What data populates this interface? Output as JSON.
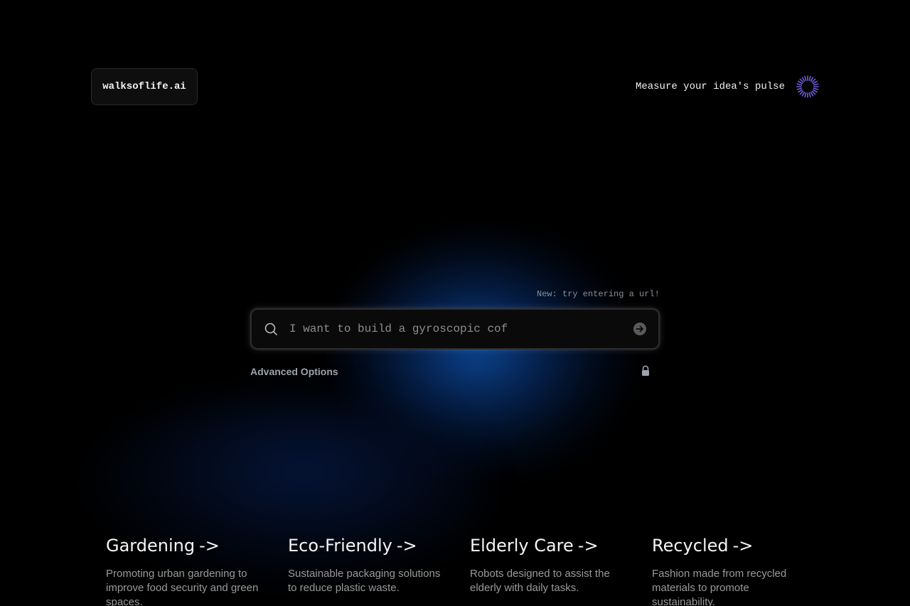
{
  "header": {
    "logo": "walksoflife.ai",
    "pulse_link": "Measure your idea's pulse"
  },
  "search": {
    "hint": "New: try entering a url!",
    "placeholder": "I want to build a gyroscopic cof",
    "advanced_label": "Advanced Options"
  },
  "colors": {
    "accent": "#6b5bd6",
    "glow": "#0c4a9c"
  },
  "icons": {
    "pulse": "spinner-icon",
    "search": "search-icon",
    "submit": "arrow-right-circle-icon",
    "lock": "lock-icon"
  },
  "cards": [
    {
      "title": "Gardening",
      "arrow": "->",
      "desc": "Promoting urban gardening to improve food security and green spaces."
    },
    {
      "title": "Eco-Friendly",
      "arrow": "->",
      "desc": "Sustainable packaging solutions to reduce plastic waste."
    },
    {
      "title": "Elderly Care",
      "arrow": "->",
      "desc": "Robots designed to assist the elderly with daily tasks."
    },
    {
      "title": "Recycled",
      "arrow": "->",
      "desc": "Fashion made from recycled materials to promote sustainability."
    }
  ]
}
